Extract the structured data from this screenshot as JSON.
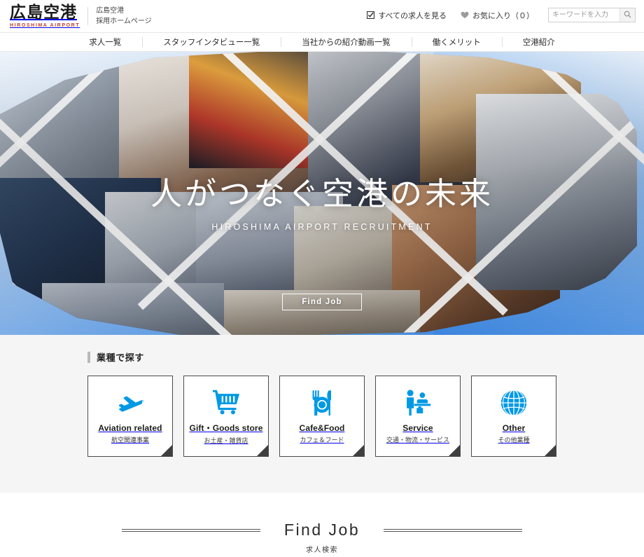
{
  "header": {
    "logo_main": "広島空港",
    "logo_sub": "HIROSHIMA AIRPORT",
    "tagline_line1": "広島空港",
    "tagline_line2": "採用ホームページ",
    "links": [
      {
        "icon": "checkbox-check-icon",
        "label": "すべての求人を見る"
      },
      {
        "icon": "heart-icon",
        "label": "お気に入り（０）"
      }
    ],
    "search": {
      "placeholder": "キーワードを入力",
      "value": "",
      "icon": "search-icon"
    }
  },
  "nav": {
    "items": [
      {
        "label": "求人一覧"
      },
      {
        "label": "スタッフインタビュー一覧"
      },
      {
        "label": "当社からの紹介動画一覧"
      },
      {
        "label": "働くメリット"
      },
      {
        "label": "空港紹介"
      }
    ]
  },
  "hero": {
    "title": "人がつなぐ空港の未来",
    "subtitle": "HIROSHIMA AIRPORT RECRUITMENT",
    "button_label": "Find Job",
    "slides": [
      {
        "index": 1,
        "active": true
      },
      {
        "index": 2,
        "active": false
      },
      {
        "index": 3,
        "active": false
      },
      {
        "index": 4,
        "active": false
      }
    ]
  },
  "categories": {
    "heading": "業種で探す",
    "cards": [
      {
        "icon": "airplane-icon",
        "en": "Aviation related",
        "ja": "航空関連事業"
      },
      {
        "icon": "shopping-cart-icon",
        "en": "Gift・Goods store",
        "ja": "お土産・雑貨店"
      },
      {
        "icon": "cutlery-plate-icon",
        "en": "Cafe&Food",
        "ja": "カフェ＆フード"
      },
      {
        "icon": "service-counter-icon",
        "en": "Service",
        "ja": "交通・物流・サービス"
      },
      {
        "icon": "globe-icon",
        "en": "Other",
        "ja": "その他業種"
      }
    ]
  },
  "findjob": {
    "title": "Find Job",
    "subtitle": "求人検索"
  },
  "colors": {
    "accent_blue": "#0099e5",
    "brand_red": "#c0392b",
    "section_gray": "#f5f5f5",
    "card_border": "#4a4a4a"
  }
}
